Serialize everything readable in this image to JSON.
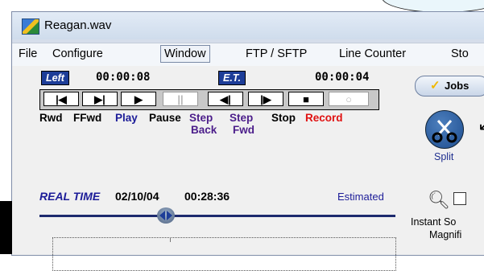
{
  "window": {
    "title": "Reagan.wav"
  },
  "menu": [
    {
      "label": "File"
    },
    {
      "label": "Configure"
    },
    {
      "label": "Window"
    },
    {
      "label": "FTP / SFTP"
    },
    {
      "label": "Line Counter"
    },
    {
      "label": "Sto"
    }
  ],
  "timers": {
    "left_badge": "Left",
    "left_time": "00:00:08",
    "et_badge": "E.T.",
    "et_time": "00:00:04"
  },
  "transport": {
    "buttons": [
      {
        "glyph": "|◀",
        "name": "rewind"
      },
      {
        "glyph": "▶|",
        "name": "fast-forward"
      },
      {
        "glyph": "▶",
        "name": "play"
      },
      {
        "glyph": "||",
        "name": "pause",
        "disabled": true
      },
      {
        "glyph": "◀|",
        "name": "step-back"
      },
      {
        "glyph": "|▶",
        "name": "step-forward"
      },
      {
        "glyph": "■",
        "name": "stop"
      },
      {
        "glyph": "○",
        "name": "record",
        "disabled": true
      }
    ],
    "labels": {
      "rwd": "Rwd",
      "ffwd": "FFwd",
      "play": "Play",
      "pause": "Pause",
      "step_back_1": "Step",
      "step_back_2": "Back",
      "step_fwd_1": "Step",
      "step_fwd_2": "Fwd",
      "stop": "Stop",
      "record": "Record"
    }
  },
  "side": {
    "jobs_label": "Jobs",
    "jobs_check": "✓",
    "split_label": "Split",
    "arrow": "↙",
    "instant_label": "Instant So",
    "magnif_label": "Magnifi"
  },
  "realtime": {
    "label": "REAL TIME",
    "date": "02/10/04",
    "time": "00:28:36",
    "estimated": "Estimated"
  },
  "colors": {
    "badge_blue": "#1d3d98",
    "play_blue": "#1c1c98",
    "record_red": "#e01010",
    "step_purple": "#4b1d8a"
  },
  "icons": {
    "app": "wav-file-icon",
    "split": "scissors-icon",
    "magnifier": "magnifier-icon",
    "slider": "slider-thumb-icon"
  }
}
